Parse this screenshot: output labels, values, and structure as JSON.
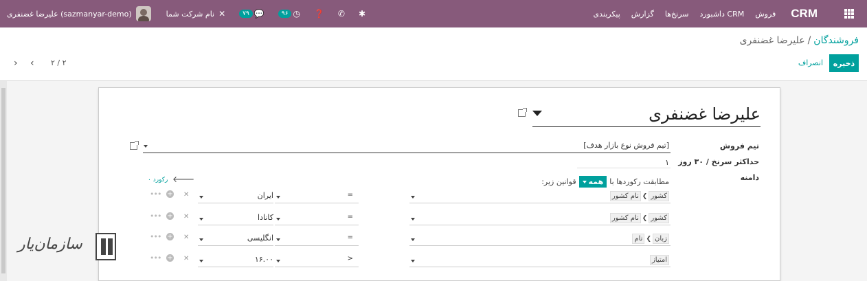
{
  "navbar": {
    "brand": "CRM",
    "menu": [
      "فروش",
      "داشبورد CRM",
      "سرنخ‌ها",
      "گزارش",
      "پیکربندی"
    ],
    "user_name": "علیرضا غضنفری (sazmanyar-demo)",
    "company": "نام شرکت شما",
    "messages_count": "۷۹",
    "activities_count": "۹۶",
    "icons": [
      "apps-icon",
      "bug-icon",
      "phone-icon",
      "help-icon",
      "clock-icon",
      "chat-icon",
      "tools-icon"
    ]
  },
  "control_panel": {
    "breadcrumb_parent": "فروشندگان",
    "breadcrumb_sep": "/",
    "breadcrumb_current": "علیرضا غضنفری",
    "save_label": "ذخیره",
    "discard_label": "انصراف",
    "pager_value": "۲ / ۲"
  },
  "form": {
    "title": "علیرضا غضنفری",
    "team_label": "تیم فروش",
    "team_value": "[تیم فروش نوع بازار هدف]",
    "max_label": "حداکثر سرنخ / ۳۰ روز",
    "max_value": "۱",
    "domain_label": "دامنه",
    "domain_prefix": "مطابقت رکوردها با",
    "domain_all": "همه",
    "domain_suffix": "قوانین زیر:",
    "record_count": "۰ رکورد",
    "rules": [
      {
        "path": [
          "کشور",
          "نام کشور"
        ],
        "operator": "=",
        "value": "ایران"
      },
      {
        "path": [
          "کشور",
          "نام کشور"
        ],
        "operator": "=",
        "value": "کانادا"
      },
      {
        "path": [
          "زبان",
          "نام"
        ],
        "operator": "=",
        "value": "انگلیسی"
      },
      {
        "path": [
          "امتیاز"
        ],
        "operator": ">",
        "value": "۱۶.۰۰"
      }
    ]
  },
  "colors": {
    "navbar": "#875a7b",
    "accent": "#00a09d"
  }
}
